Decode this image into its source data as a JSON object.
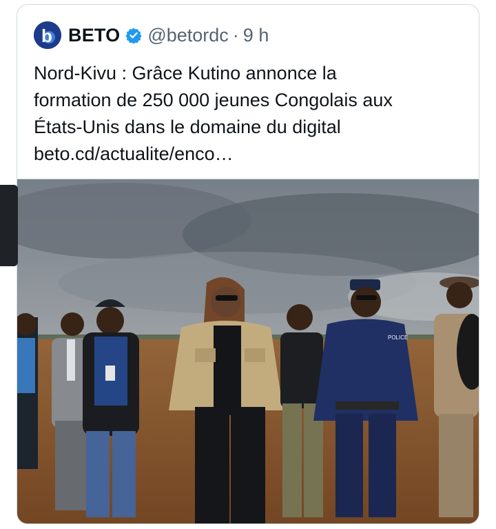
{
  "tweet": {
    "author_name": "BETO",
    "avatar_letter": "b",
    "handle": "@betordc",
    "separator": "·",
    "time": "9 h",
    "verified": true,
    "text_lines": [
      "Nord-Kivu : Grâce Kutino annonce la",
      "formation de 250 000 jeunes Congolais aux",
      "États-Unis dans le domaine du digital"
    ],
    "link": "beto.cd/actualite/enco…",
    "media": {
      "uniform_label": "POLICE",
      "icons": {
        "verified": "verified-badge-icon"
      }
    }
  },
  "colors": {
    "verified": "#1d9bf0",
    "avatar": "#1d3b8a",
    "text": "#0f1419",
    "secondary": "#536471",
    "border": "#cfd9de"
  }
}
